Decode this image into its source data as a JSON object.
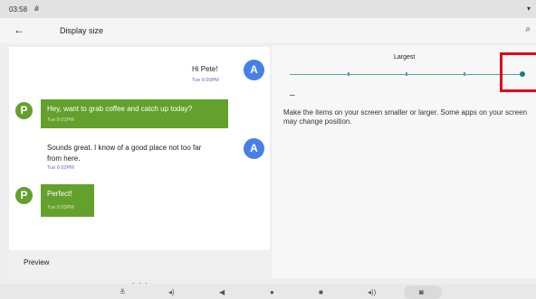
{
  "status": {
    "time": "03:58",
    "sync_glyph": "ǿ",
    "wifi_glyph": "▾"
  },
  "appbar": {
    "title": "Display size",
    "back_glyph": "←",
    "search_glyph": "⌕"
  },
  "preview": {
    "m1": {
      "text": "Hi Pete!",
      "time": "Tue 6:00PM",
      "avatar": "A"
    },
    "m2": {
      "text": "Hey, want to grab coffee and catch up today?",
      "time": "Tue 6:01PM",
      "avatar": "P"
    },
    "m3": {
      "line1": "Sounds great. I know of a good place not too far",
      "line2": "from here.",
      "time": "Tue 6:02PM",
      "avatar": "A"
    },
    "m4": {
      "text": "Perfect!",
      "time": "Tue 6:03PM",
      "avatar": "P"
    },
    "label": "Preview",
    "page_dots": "• • •"
  },
  "slider": {
    "title": "Largest",
    "minus_glyph": "–",
    "steps": 5,
    "selected_index": 4,
    "description": "Make the items on your screen smaller or larger. Some apps on your screen may change position."
  },
  "navbar": {
    "collapse_glyph": "≚",
    "vol_down_glyph": "◂)",
    "back_glyph": "◀",
    "home_glyph": "●",
    "recents_glyph": "■",
    "vol_up_glyph": "◂))",
    "camera_glyph": "◙"
  },
  "colors": {
    "accent": "#10807e",
    "highlight": "#e0001e",
    "avatar_a": "#4680e6",
    "avatar_p": "#64a02c"
  }
}
